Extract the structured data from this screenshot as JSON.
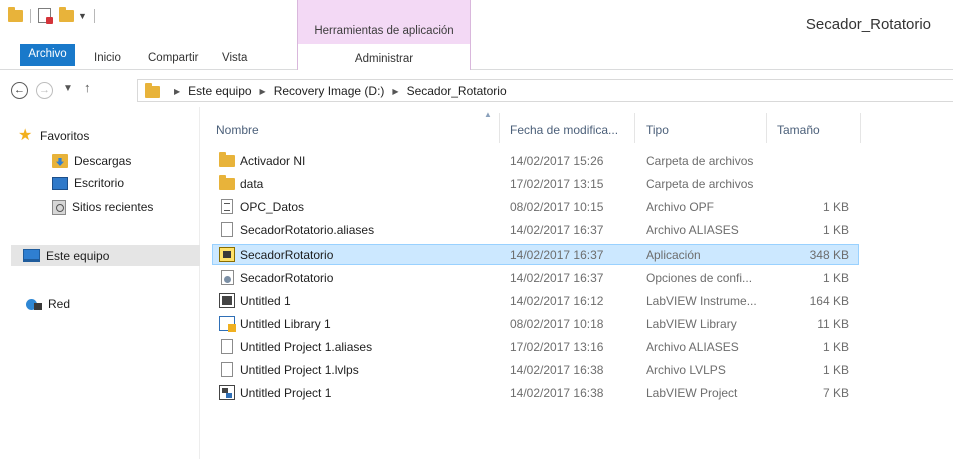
{
  "window": {
    "title": "Secador_Rotatorio",
    "context_tab_group": "Herramientas de aplicación"
  },
  "ribbon": {
    "tabs": [
      "Archivo",
      "Inicio",
      "Compartir",
      "Vista"
    ],
    "context_tab": "Administrar"
  },
  "address": {
    "breadcrumbs": [
      "Este equipo",
      "Recovery Image (D:)",
      "Secador_Rotatorio"
    ]
  },
  "navpane": {
    "items": [
      {
        "label": "Favoritos",
        "icon": "star-icon"
      },
      {
        "label": "Descargas",
        "icon": "downloads-folder-icon"
      },
      {
        "label": "Escritorio",
        "icon": "desktop-icon"
      },
      {
        "label": "Sitios recientes",
        "icon": "recent-places-icon"
      },
      {
        "label": "Este equipo",
        "icon": "computer-icon",
        "selected": true
      },
      {
        "label": "Red",
        "icon": "network-icon"
      }
    ]
  },
  "filelist": {
    "columns": {
      "name": "Nombre",
      "date": "Fecha de modifica...",
      "type": "Tipo",
      "size": "Tamaño"
    },
    "rows": [
      {
        "name": "Activador NI",
        "date": "14/02/2017 15:26",
        "type": "Carpeta de archivos",
        "size": "",
        "icon": "folder-icon"
      },
      {
        "name": "data",
        "date": "17/02/2017 13:15",
        "type": "Carpeta de archivos",
        "size": "",
        "icon": "folder-icon"
      },
      {
        "name": "OPC_Datos",
        "date": "08/02/2017 10:15",
        "type": "Archivo OPF",
        "size": "1 KB",
        "icon": "opf-file-icon"
      },
      {
        "name": "SecadorRotatorio.aliases",
        "date": "14/02/2017 16:37",
        "type": "Archivo ALIASES",
        "size": "1 KB",
        "icon": "blank-file-icon"
      },
      {
        "name": "SecadorRotatorio",
        "date": "14/02/2017 16:37",
        "type": "Aplicación",
        "size": "348 KB",
        "icon": "application-icon",
        "selected": true
      },
      {
        "name": "SecadorRotatorio",
        "date": "14/02/2017 16:37",
        "type": "Opciones de confi...",
        "size": "1 KB",
        "icon": "config-file-icon"
      },
      {
        "name": "Untitled 1",
        "date": "14/02/2017 16:12",
        "type": "LabVIEW Instrume...",
        "size": "164 KB",
        "icon": "labview-vi-icon"
      },
      {
        "name": "Untitled Library 1",
        "date": "08/02/2017 10:18",
        "type": "LabVIEW Library",
        "size": "11 KB",
        "icon": "labview-library-icon"
      },
      {
        "name": "Untitled Project 1.aliases",
        "date": "17/02/2017 13:16",
        "type": "Archivo ALIASES",
        "size": "1 KB",
        "icon": "blank-file-icon"
      },
      {
        "name": "Untitled Project 1.lvlps",
        "date": "14/02/2017 16:38",
        "type": "Archivo LVLPS",
        "size": "1 KB",
        "icon": "blank-file-icon"
      },
      {
        "name": "Untitled Project 1",
        "date": "14/02/2017 16:38",
        "type": "LabVIEW Project",
        "size": "7 KB",
        "icon": "labview-project-icon"
      }
    ]
  },
  "colors": {
    "file_tab": "#1979ca",
    "context_tab": "#f3d9f5",
    "selection": "#cce8ff",
    "selection_border": "#99d1ff",
    "nav_selected": "#e5e5e5",
    "folder": "#e8b33a"
  }
}
